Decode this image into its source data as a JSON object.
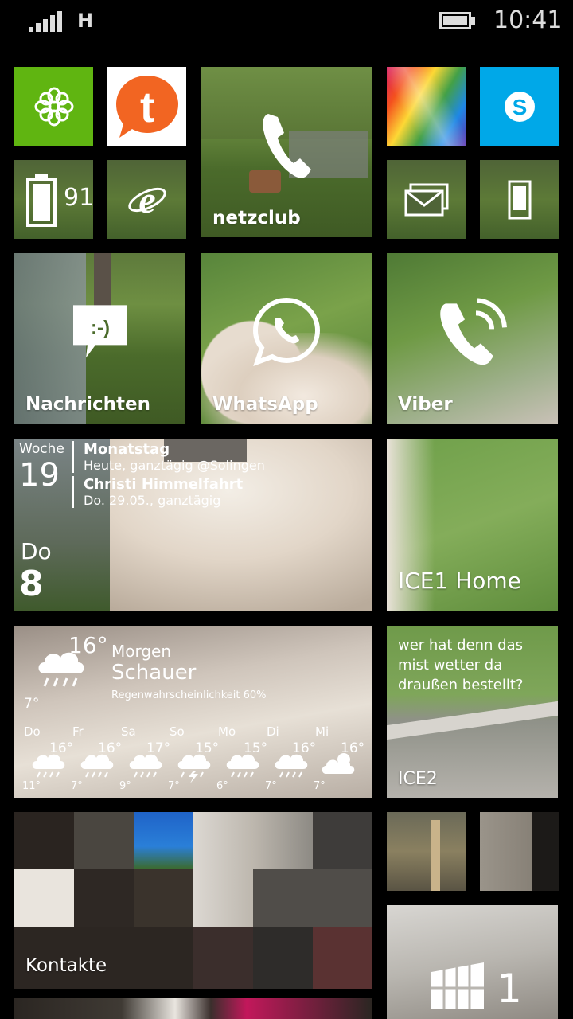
{
  "status": {
    "network": "H",
    "time": "10:41"
  },
  "tiles": {
    "battery": {
      "value": "91"
    },
    "netzclub": {
      "label": "netzclub"
    },
    "nachrichten": {
      "label": "Nachrichten"
    },
    "whatsapp": {
      "label": "WhatsApp"
    },
    "viber": {
      "label": "Viber"
    },
    "calendar": {
      "week_label": "Woche",
      "week_number": "19",
      "day_name": "Do",
      "day_number": "8",
      "events": [
        {
          "title": "Monatstag",
          "detail": "Heute, ganztägig @Solingen"
        },
        {
          "title": "Christi Himmelfahrt",
          "detail": "Do. 29.05., ganztägig"
        }
      ]
    },
    "ice1": {
      "label": "ICE1 Home"
    },
    "weather": {
      "high": "16°",
      "low": "7°",
      "when": "Morgen",
      "condition": "Schauer",
      "chance": "Regenwahrscheinlichkeit 60%",
      "days": [
        {
          "day": "Do",
          "high": "16°",
          "low": "11°",
          "icon": "rain-cloud-icon"
        },
        {
          "day": "Fr",
          "high": "16°",
          "low": "7°",
          "icon": "rain-cloud-icon"
        },
        {
          "day": "Sa",
          "high": "17°",
          "low": "9°",
          "icon": "rain-cloud-icon"
        },
        {
          "day": "So",
          "high": "15°",
          "low": "7°",
          "icon": "thunder-cloud-icon"
        },
        {
          "day": "Mo",
          "high": "15°",
          "low": "6°",
          "icon": "rain-cloud-icon"
        },
        {
          "day": "Di",
          "high": "16°",
          "low": "7°",
          "icon": "rain-cloud-icon"
        },
        {
          "day": "Mi",
          "high": "16°",
          "low": "7°",
          "icon": "partly-cloudy-icon"
        }
      ]
    },
    "ice2": {
      "message": "wer hat denn das mist wetter da draußen bestellt?",
      "label": "ICE2"
    },
    "kontakte": {
      "label": "Kontakte"
    },
    "store": {
      "count": "1"
    }
  },
  "colors": {
    "green_tile": "#60b511",
    "skype_blue": "#00a8e8",
    "orange_t": "#f26522"
  }
}
